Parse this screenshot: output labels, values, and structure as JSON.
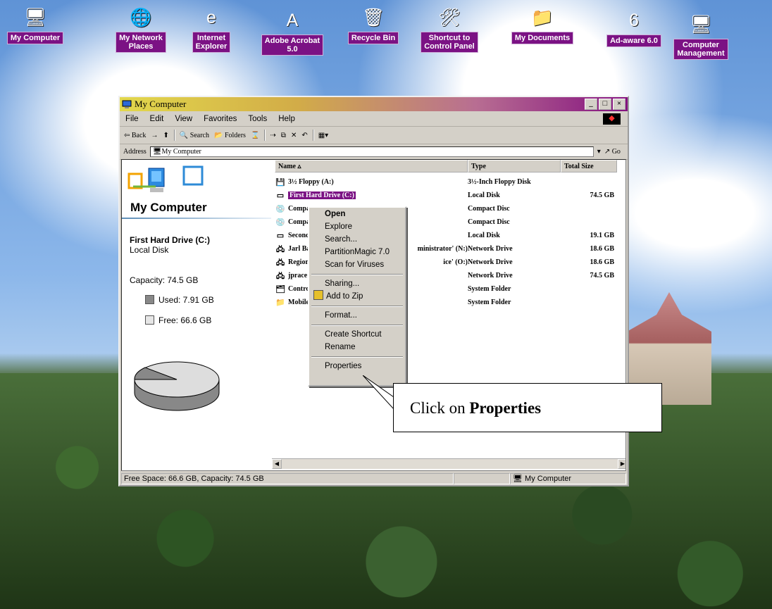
{
  "desktop": {
    "icons": [
      {
        "label": "My Computer",
        "symbol": "🖥"
      },
      {
        "label": "My Network\nPlaces",
        "symbol": "🌐"
      },
      {
        "label": "Internet\nExplorer",
        "symbol": "e"
      },
      {
        "label": "Adobe Acrobat\n5.0",
        "symbol": "A"
      },
      {
        "label": "Recycle Bin",
        "symbol": "🗑"
      },
      {
        "label": "Shortcut to\nControl Panel",
        "symbol": "🛠"
      },
      {
        "label": "My Documents",
        "symbol": "📁"
      },
      {
        "label": "Ad-aware 6.0",
        "symbol": "6"
      },
      {
        "label": "Computer\nManagement",
        "symbol": "🖥"
      }
    ]
  },
  "window": {
    "title": "My Computer",
    "menu": [
      "File",
      "Edit",
      "View",
      "Favorites",
      "Tools",
      "Help"
    ],
    "toolbar": {
      "back": "⇦ Back",
      "search": "Search",
      "folders": "Folders"
    },
    "address": {
      "label": "Address",
      "value": "My Computer",
      "go": "Go"
    },
    "left": {
      "title": "My Computer",
      "drive": "First Hard Drive (C:)",
      "drive_type": "Local Disk",
      "capacity": "Capacity: 74.5 GB",
      "used": "Used: 7.91 GB",
      "free": "Free: 66.6 GB"
    },
    "columns": [
      "Name",
      "Type",
      "Total Size"
    ],
    "files": [
      {
        "name": "3½ Floppy (A:)",
        "type": "3½-Inch Floppy Disk",
        "size": "",
        "icon": "💾"
      },
      {
        "name": "First Hard Drive (C:)",
        "type": "Local Disk",
        "size": "74.5 GB",
        "icon": "▭",
        "selected": true
      },
      {
        "name": "Compa",
        "type": "Compact Disc",
        "size": "",
        "icon": "💿"
      },
      {
        "name": "Compa",
        "type": "Compact Disc",
        "size": "",
        "icon": "💿"
      },
      {
        "name": "Second",
        "type": "Local Disk",
        "size": "19.1 GB",
        "icon": "▭"
      },
      {
        "name": "Jarl Ba",
        "tail": "ministrator' (N:)",
        "type": "Network Drive",
        "size": "18.6 GB",
        "icon": "🖧"
      },
      {
        "name": "Region",
        "tail": "ice' (O:)",
        "type": "Network Drive",
        "size": "18.6 GB",
        "icon": "🖧"
      },
      {
        "name": "jprace",
        "type": "Network Drive",
        "size": "74.5 GB",
        "icon": "🖧"
      },
      {
        "name": "Control",
        "type": "System Folder",
        "size": "",
        "icon": "🗂"
      },
      {
        "name": "Mobile",
        "type": "System Folder",
        "size": "",
        "icon": "📁"
      }
    ],
    "status": {
      "left": "Free Space: 66.6 GB, Capacity: 74.5 GB",
      "right": "My Computer"
    }
  },
  "context_menu": {
    "items": [
      "Open",
      "Explore",
      "Search...",
      "PartitionMagic 7.0",
      "Scan for Viruses",
      "Sharing...",
      "Add to Zip",
      "Format...",
      "Create Shortcut",
      "Rename",
      "Properties"
    ]
  },
  "callout": {
    "prefix": "Click on ",
    "bold": "Properties"
  },
  "colors": {
    "selection": "#7b1284",
    "window": "#d4d0c8",
    "title_start": "#e2d84c",
    "title_end": "#84117f"
  },
  "disk_usage": {
    "used_fraction": 0.106,
    "free_fraction": 0.894
  }
}
